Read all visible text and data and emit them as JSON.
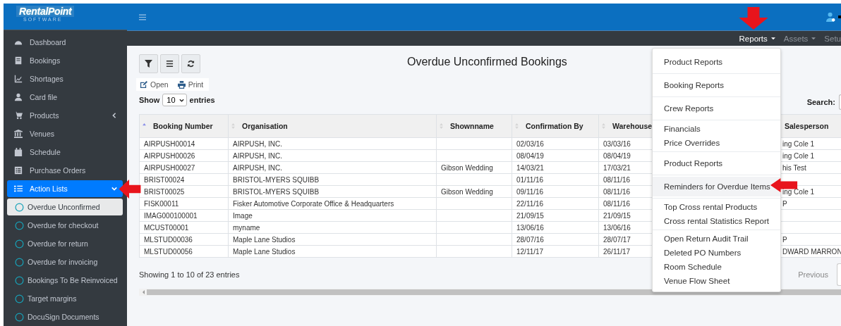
{
  "logo": {
    "name": "RentalPoint",
    "tagline": "SOFTWARE"
  },
  "sidebar": {
    "items": [
      {
        "label": "Dashboard",
        "kind": "link",
        "selected": false
      },
      {
        "label": "Bookings",
        "kind": "link",
        "selected": false
      },
      {
        "label": "Shortages",
        "kind": "link",
        "selected": false
      },
      {
        "label": "Card file",
        "kind": "link",
        "selected": false
      },
      {
        "label": "Products",
        "kind": "group",
        "selected": false,
        "expanded": false
      },
      {
        "label": "Venues",
        "kind": "link",
        "selected": false
      },
      {
        "label": "Schedule",
        "kind": "link",
        "selected": false
      },
      {
        "label": "Purchase Orders",
        "kind": "link",
        "selected": false
      },
      {
        "label": "Action Lists",
        "kind": "group",
        "selected": true,
        "expanded": true,
        "children": [
          {
            "label": "Overdue Unconfirmed",
            "selected": true
          },
          {
            "label": "Overdue for checkout",
            "selected": false
          },
          {
            "label": "Overdue for return",
            "selected": false
          },
          {
            "label": "Overdue for invoicing",
            "selected": false
          },
          {
            "label": "Bookings To Be Reinvoiced",
            "selected": false
          },
          {
            "label": "Target margins",
            "selected": false
          },
          {
            "label": "DocuSign Documents",
            "selected": false
          }
        ]
      }
    ]
  },
  "nav": [
    {
      "label": "Reports",
      "selected": true
    },
    {
      "label": "Assets",
      "selected": false
    },
    {
      "label": "Setu",
      "selected": false
    }
  ],
  "page": {
    "title": "Overdue Unconfirmed Bookings",
    "actions": [
      "Open",
      "Print"
    ],
    "show_label": "Show",
    "page_size": "10",
    "entries_label": "entries",
    "search_label": "Search:",
    "info": "Showing 1 to 10 of 23 entries",
    "previous": "Previous"
  },
  "table": {
    "columns": [
      {
        "label": "Booking Number",
        "sorted": true
      },
      {
        "label": "Organisation",
        "sorted": false
      },
      {
        "label": "Shownname",
        "sorted": false
      },
      {
        "label": "Confirmation By",
        "sorted": false
      },
      {
        "label": "Warehouse",
        "sorted": false
      },
      {
        "label": "Salesperson"
      }
    ],
    "rows": [
      [
        "AIRPUSH00014",
        "AIRPUSH, INC.",
        "",
        "02/03/16",
        "03/03/16",
        "ing Cole 1"
      ],
      [
        "AIRPUSH00026",
        "AIRPUSH, INC.",
        "",
        "08/04/19",
        "08/04/19",
        "ing Cole 1"
      ],
      [
        "AIRPUSH00027",
        "AIRPUSH, INC.",
        "Gibson Wedding",
        "14/03/21",
        "17/03/21",
        "his Test"
      ],
      [
        "BRIST00024",
        "BRISTOL-MYERS SQUIBB",
        "",
        "01/11/16",
        "08/11/16",
        ""
      ],
      [
        "BRIST00025",
        "BRISTOL-MYERS SQUIBB",
        "Gibson Wedding",
        "09/11/16",
        "08/11/16",
        "ing Cole 1"
      ],
      [
        "FISK00011",
        "Fisker Automotive Corporate Office & Headquarters",
        "",
        "22/11/16",
        "08/11/16",
        "P"
      ],
      [
        "IMAG000100001",
        "Image",
        "",
        "21/09/15",
        "21/09/15",
        ""
      ],
      [
        "MCUST00001",
        "myname",
        "",
        "13/06/16",
        "13/06/16",
        ""
      ],
      [
        "MLSTUD00036",
        "Maple Lane Studios",
        "",
        "28/07/16",
        "28/07/17",
        "P"
      ],
      [
        "MLSTUD00056",
        "Maple Lane Studios",
        "",
        "12/11/17",
        "26/11/17",
        "DWARD MARRON"
      ]
    ]
  },
  "reports_menu": {
    "groups": [
      [
        {
          "label": "Product Reports",
          "selected": false
        }
      ],
      [
        {
          "label": "Booking Reports",
          "selected": false
        }
      ],
      [
        {
          "label": "Crew Reports",
          "selected": false
        }
      ],
      [
        {
          "label": "Financials",
          "selected": false
        },
        {
          "label": "Price Overrides",
          "selected": false
        }
      ],
      [
        {
          "label": "Product Reports",
          "selected": false
        }
      ],
      [
        {
          "label": "Reminders for Overdue Items",
          "selected": true
        }
      ],
      [
        {
          "label": "Top Cross rental Products",
          "selected": false
        },
        {
          "label": "Cross rental Statistics Report",
          "selected": false
        }
      ],
      [
        {
          "label": "Open Return Audit Trail",
          "selected": false
        },
        {
          "label": "Deleted PO Numbers",
          "selected": false
        },
        {
          "label": "Room Schedule",
          "selected": false
        },
        {
          "label": "Venue Flow Sheet",
          "selected": false
        }
      ]
    ]
  }
}
